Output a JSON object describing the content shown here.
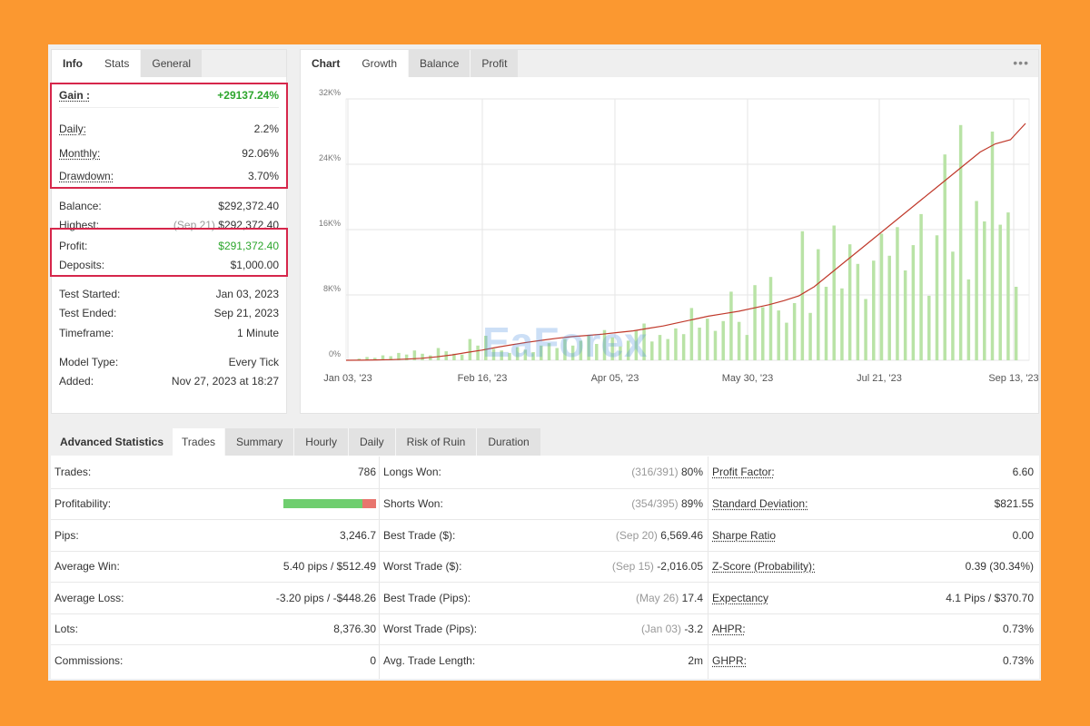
{
  "info": {
    "tabs": [
      "Info",
      "Stats",
      "General"
    ],
    "gain": {
      "label": "Gain :",
      "value": "+29137.24%"
    },
    "daily": {
      "label": "Daily:",
      "value": "2.2%"
    },
    "monthly": {
      "label": "Monthly:",
      "value": "92.06%"
    },
    "drawdown": {
      "label": "Drawdown:",
      "value": "3.70%"
    },
    "balance": {
      "label": "Balance:",
      "value": "$292,372.40"
    },
    "highest": {
      "label": "Highest:",
      "date": "(Sep 21)",
      "value": "$292,372.40"
    },
    "profit": {
      "label": "Profit:",
      "value": "$291,372.40"
    },
    "deposits": {
      "label": "Deposits:",
      "value": "$1,000.00"
    },
    "test_started": {
      "label": "Test Started:",
      "value": "Jan 03, 2023"
    },
    "test_ended": {
      "label": "Test Ended:",
      "value": "Sep 21, 2023"
    },
    "timeframe": {
      "label": "Timeframe:",
      "value": "1 Minute"
    },
    "model_type": {
      "label": "Model Type:",
      "value": "Every Tick"
    },
    "added": {
      "label": "Added:",
      "value": "Nov 27, 2023 at 18:27"
    }
  },
  "chart_panel": {
    "tabs": [
      "Chart",
      "Growth",
      "Balance",
      "Profit"
    ],
    "menu_icon": "more-dots-icon",
    "watermark": "EaForex"
  },
  "chart_data": {
    "type": "bar",
    "yticks": [
      "32K%",
      "24K%",
      "16K%",
      "8K%",
      "0%"
    ],
    "xticks": [
      "Jan 03, '23",
      "Feb 16, '23",
      "Apr 05, '23",
      "May 30, '23",
      "Jul 21, '23",
      "Sep 13, '23"
    ],
    "ylim": [
      0,
      32000
    ],
    "grid": true,
    "line_color": "#c0392b",
    "bar_color": "#b9e3a6",
    "growth_line": [
      0,
      10,
      40,
      80,
      140,
      250,
      420,
      650,
      950,
      1250,
      1600,
      1900,
      2200,
      2450,
      2700,
      2900,
      3050,
      3200,
      3400,
      3600,
      3900,
      4200,
      4600,
      5000,
      5400,
      5700,
      6000,
      6400,
      6800,
      7300,
      7900,
      9000,
      10500,
      12000,
      13500,
      15000,
      16500,
      18000,
      19500,
      21000,
      22500,
      24000,
      25500,
      26500,
      27000,
      29000
    ],
    "bars": [
      200,
      400,
      300,
      600,
      500,
      900,
      700,
      1200,
      800,
      600,
      1500,
      1100,
      800,
      700,
      2600,
      1800,
      3000,
      1400,
      1200,
      900,
      1600,
      1300,
      1000,
      1800,
      2100,
      1500,
      2600,
      1800,
      2400,
      3100,
      2000,
      3700,
      2800,
      1700,
      2400,
      3600,
      4500,
      2300,
      3100,
      2600,
      3900,
      3200,
      6400,
      4000,
      5100,
      3600,
      4800,
      8400,
      4700,
      3100,
      9200,
      6500,
      10200,
      6100,
      4600,
      7000,
      15800,
      5800,
      13600,
      9000,
      16500,
      8800,
      14200,
      11800,
      7500,
      12200,
      15500,
      12800,
      16300,
      11000,
      14100,
      17900,
      7900,
      15300,
      25200,
      13300,
      28800,
      9900,
      19500,
      17000,
      28000,
      16600,
      18100,
      9000
    ]
  },
  "advanced": {
    "tabs": [
      "Advanced Statistics",
      "Trades",
      "Summary",
      "Hourly",
      "Daily",
      "Risk of Ruin",
      "Duration"
    ],
    "col1": [
      {
        "label": "Trades:",
        "value": "786"
      },
      {
        "label": "Profitability:",
        "value": ""
      },
      {
        "label": "Pips:",
        "value": "3,246.7"
      },
      {
        "label": "Average Win:",
        "value": "5.40 pips / $512.49"
      },
      {
        "label": "Average Loss:",
        "value": "-3.20 pips / -$448.26"
      },
      {
        "label": "Lots:",
        "value": "8,376.30"
      },
      {
        "label": "Commissions:",
        "value": "0"
      }
    ],
    "profitability_fraction": 0.85,
    "col2": [
      {
        "label": "Longs Won:",
        "pre": "(316/391)",
        "value": "80%"
      },
      {
        "label": "Shorts Won:",
        "pre": "(354/395)",
        "value": "89%"
      },
      {
        "label": "Best Trade ($):",
        "pre": "(Sep 20)",
        "value": "6,569.46"
      },
      {
        "label": "Worst Trade ($):",
        "pre": "(Sep 15)",
        "value": "-2,016.05"
      },
      {
        "label": "Best Trade (Pips):",
        "pre": "(May 26)",
        "value": "17.4"
      },
      {
        "label": "Worst Trade (Pips):",
        "pre": "(Jan 03)",
        "value": "-3.2"
      },
      {
        "label": "Avg. Trade Length:",
        "pre": "",
        "value": "2m"
      }
    ],
    "col3": [
      {
        "label": "Profit Factor:",
        "value": "6.60"
      },
      {
        "label": "Standard Deviation:",
        "value": "$821.55"
      },
      {
        "label": "Sharpe Ratio",
        "value": "0.00"
      },
      {
        "label": "Z-Score (Probability):",
        "value": "0.39 (30.34%)"
      },
      {
        "label": "Expectancy",
        "value": "4.1 Pips / $370.70"
      },
      {
        "label": "AHPR:",
        "value": "0.73%"
      },
      {
        "label": "GHPR:",
        "value": "0.73%"
      }
    ]
  }
}
